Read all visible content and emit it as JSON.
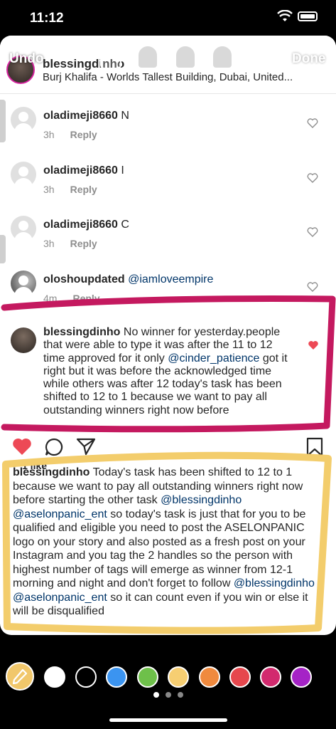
{
  "status_bar": {
    "time": "11:12"
  },
  "toolbar": {
    "undo": "Undo",
    "done": "Done",
    "tools": [
      "marker-pen-icon",
      "highlighter-icon",
      "neon-pen-icon",
      "eraser-icon"
    ]
  },
  "header": {
    "username": "blessingdinho",
    "location": "Burj Khalifa - Worlds Tallest Building, Dubai, United..."
  },
  "comments": [
    {
      "user": "oladimeji8660",
      "text": "N",
      "time": "3h",
      "reply": "Reply"
    },
    {
      "user": "oladimeji8660",
      "text": "I",
      "time": "3h",
      "reply": "Reply"
    },
    {
      "user": "oladimeji8660",
      "text": "C",
      "time": "3h",
      "reply": "Reply"
    },
    {
      "user": "oloshoupdated",
      "mention": "@iamloveempire",
      "time": "4m",
      "reply": "Reply"
    }
  ],
  "highlight_comment": {
    "user": "blessingdinho",
    "text_a": " No winner for yesterday.people that were able to type it was after the 11 to 12 time approved for it only ",
    "mention": "@cinder_patience",
    "text_b": " got it right but it was before the acknowledged time while others was after 12 today's task has been shifted to 12 to 1 because we want to pay all outstanding winners right  now before"
  },
  "likes": "1 like",
  "caption": {
    "user": "blessingdinho",
    "text_a": " Today's task has been shifted to 12 to 1 because we want to pay all outstanding winners right now before starting the other task  ",
    "mention_1": "@blessingdinho",
    "mention_2": "@aselonpanic_ent",
    "text_b": " so today's task is just that for you to be qualified and eligible you need to post the ASELONPANIC logo on your story and also posted as a fresh post on your Instagram and  you tag the 2 handles so the person with highest number of tags will emerge as winner from 12-1 morning and night and don't forget to follow ",
    "mention_3": "@blessingdinho",
    "mention_4": "@aselonpanic_ent",
    "text_c": " so it can count even if you win or else it will be disqualified"
  },
  "palette": {
    "colors": [
      "#ffffff",
      "#000000",
      "#3b94f0",
      "#6ec04a",
      "#f6ce72",
      "#f08a3e",
      "#e6474d",
      "#d22a6e",
      "#a523c6"
    ],
    "selected": "#f6ce72"
  },
  "accents": {
    "like_red": "#ed4956",
    "mention_blue": "#003569",
    "pink_marker": "#c4195f",
    "yellow_marker": "#f3cd6c"
  }
}
